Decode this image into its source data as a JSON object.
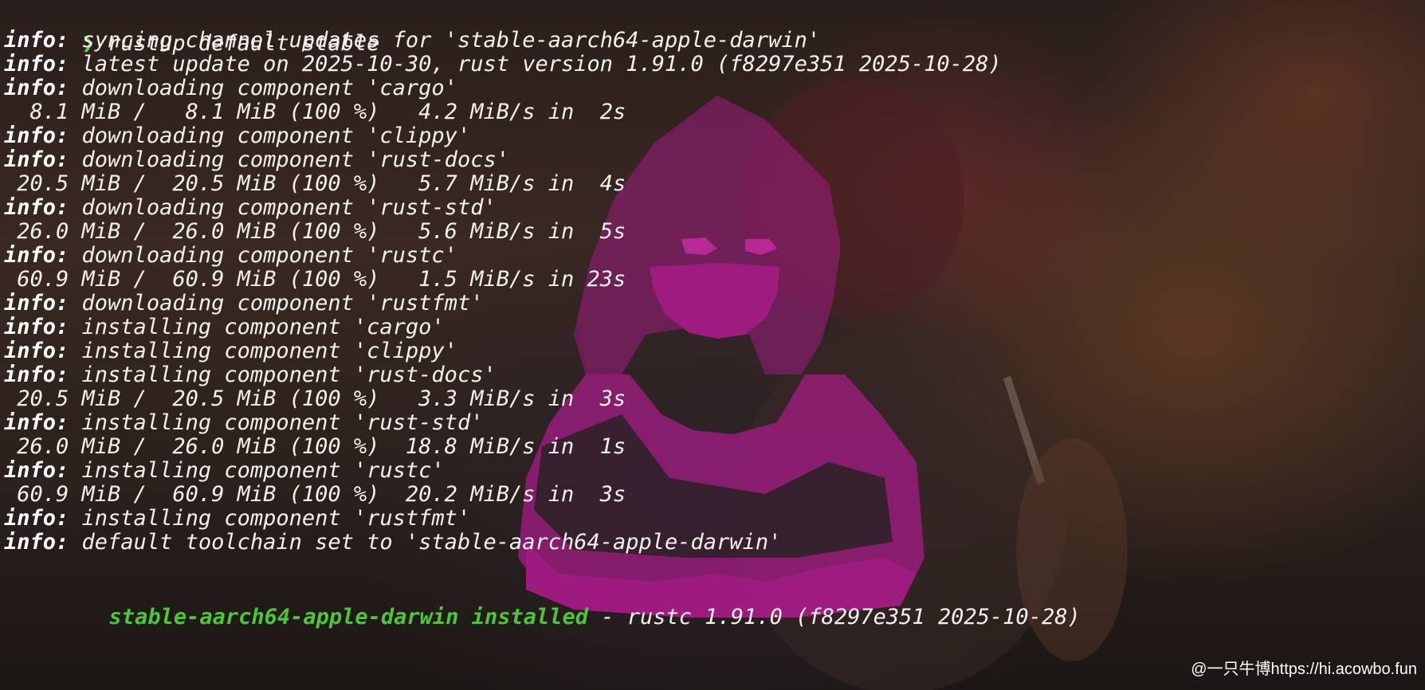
{
  "terminal": {
    "prompt_symbol": "❯",
    "command": " rustup default stable",
    "lines": [
      {
        "prefix": "info:",
        "text": " syncing channel updates for 'stable-aarch64-apple-darwin'"
      },
      {
        "prefix": "info:",
        "text": " latest update on 2025-10-30, rust version 1.91.0 (f8297e351 2025-10-28)"
      },
      {
        "prefix": "info:",
        "text": " downloading component 'cargo'"
      },
      {
        "prefix": "",
        "text": "  8.1 MiB /   8.1 MiB (100 %)   4.2 MiB/s in  2s"
      },
      {
        "prefix": "info:",
        "text": " downloading component 'clippy'"
      },
      {
        "prefix": "info:",
        "text": " downloading component 'rust-docs'"
      },
      {
        "prefix": "",
        "text": " 20.5 MiB /  20.5 MiB (100 %)   5.7 MiB/s in  4s"
      },
      {
        "prefix": "info:",
        "text": " downloading component 'rust-std'"
      },
      {
        "prefix": "",
        "text": " 26.0 MiB /  26.0 MiB (100 %)   5.6 MiB/s in  5s"
      },
      {
        "prefix": "info:",
        "text": " downloading component 'rustc'"
      },
      {
        "prefix": "",
        "text": " 60.9 MiB /  60.9 MiB (100 %)   1.5 MiB/s in 23s"
      },
      {
        "prefix": "info:",
        "text": " downloading component 'rustfmt'"
      },
      {
        "prefix": "info:",
        "text": " installing component 'cargo'"
      },
      {
        "prefix": "info:",
        "text": " installing component 'clippy'"
      },
      {
        "prefix": "info:",
        "text": " installing component 'rust-docs'"
      },
      {
        "prefix": "",
        "text": " 20.5 MiB /  20.5 MiB (100 %)   3.3 MiB/s in  3s"
      },
      {
        "prefix": "info:",
        "text": " installing component 'rust-std'"
      },
      {
        "prefix": "",
        "text": " 26.0 MiB /  26.0 MiB (100 %)  18.8 MiB/s in  1s"
      },
      {
        "prefix": "info:",
        "text": " installing component 'rustc'"
      },
      {
        "prefix": "",
        "text": " 60.9 MiB /  60.9 MiB (100 %)  20.2 MiB/s in  3s"
      },
      {
        "prefix": "info:",
        "text": " installing component 'rustfmt'"
      },
      {
        "prefix": "info:",
        "text": " default toolchain set to 'stable-aarch64-apple-darwin'"
      }
    ],
    "summary": {
      "toolchain": "stable-aarch64-apple-darwin installed",
      "detail": " - rustc 1.91.0 (f8297e351 2025-10-28)"
    }
  },
  "watermark": "@一只牛博https://hi.acowbo.fun",
  "colors": {
    "prompt_green": "#56d23f",
    "summary_green": "#4ec638",
    "hoodie_magenta": "#b0208f"
  },
  "icons": {
    "prompt": "chevron-right-icon",
    "wallpaper_figure": "hooded-figure-icon"
  }
}
